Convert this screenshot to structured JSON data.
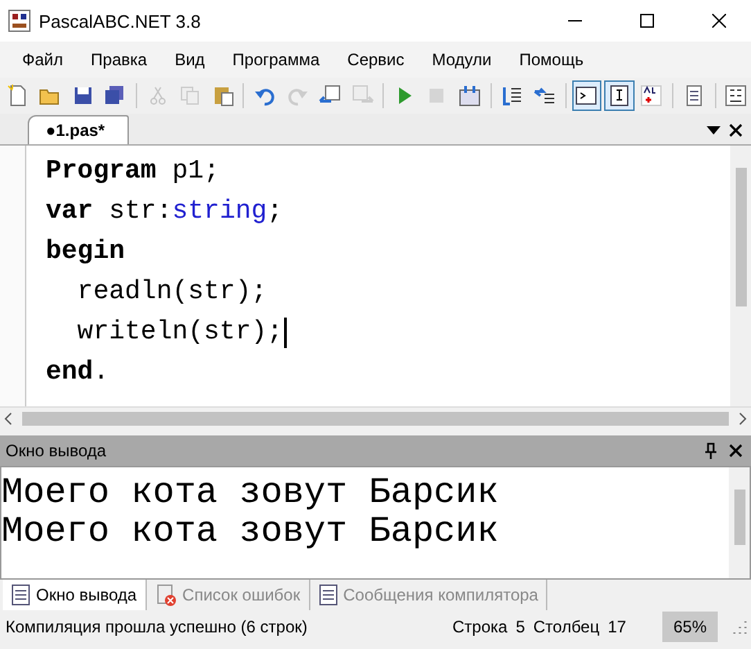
{
  "window": {
    "title": "PascalABC.NET 3.8"
  },
  "menu": [
    "Файл",
    "Правка",
    "Вид",
    "Программа",
    "Сервис",
    "Модули",
    "Помощь"
  ],
  "toolbar": {
    "buttons": [
      {
        "selected": false,
        "disabled": false
      },
      {
        "selected": false,
        "disabled": false
      },
      {
        "selected": false,
        "disabled": false
      },
      {
        "selected": false,
        "disabled": false
      },
      {
        "selected": false,
        "disabled": true
      },
      {
        "selected": false,
        "disabled": true
      },
      {
        "selected": false,
        "disabled": false
      },
      {
        "selected": false,
        "disabled": false
      },
      {
        "selected": false,
        "disabled": true
      },
      {
        "selected": false,
        "disabled": false
      },
      {
        "selected": false,
        "disabled": true
      },
      {
        "selected": false,
        "disabled": false
      },
      {
        "selected": false,
        "disabled": true
      },
      {
        "selected": false,
        "disabled": false
      },
      {
        "selected": false,
        "disabled": false
      },
      {
        "selected": false,
        "disabled": false
      },
      {
        "selected": true,
        "disabled": false
      },
      {
        "selected": true,
        "disabled": false
      },
      {
        "selected": false,
        "disabled": false
      },
      {
        "selected": false,
        "disabled": false
      },
      {
        "selected": false,
        "disabled": false
      }
    ]
  },
  "editor_tabs": [
    {
      "label": "●1.pas*",
      "selected": true
    }
  ],
  "code_lines": [
    {
      "cursor": false,
      "segments": [
        {
          "text": "Program",
          "kind": "keyword"
        },
        {
          "text": " p1;",
          "kind": "plain"
        }
      ]
    },
    {
      "cursor": false,
      "segments": [
        {
          "text": "var",
          "kind": "keyword"
        },
        {
          "text": " str:",
          "kind": "plain"
        },
        {
          "text": "string",
          "kind": "type"
        },
        {
          "text": ";",
          "kind": "plain"
        }
      ]
    },
    {
      "cursor": false,
      "segments": [
        {
          "text": "begin",
          "kind": "keyword"
        }
      ]
    },
    {
      "cursor": false,
      "segments": [
        {
          "text": "  readln(str);",
          "kind": "plain"
        }
      ]
    },
    {
      "cursor": true,
      "segments": [
        {
          "text": "  writeln(str);",
          "kind": "plain"
        }
      ]
    },
    {
      "cursor": false,
      "segments": [
        {
          "text": "end",
          "kind": "keyword"
        },
        {
          "text": ".",
          "kind": "plain"
        }
      ]
    }
  ],
  "output_panel": {
    "title": "Окно вывода",
    "lines": [
      "Моего кота зовут Барсик",
      "Моего кота зовут Барсик"
    ]
  },
  "bottom_tabs": [
    {
      "label": "Окно вывода",
      "selected": true
    },
    {
      "label": "Список ошибок",
      "selected": false
    },
    {
      "label": "Сообщения компилятора",
      "selected": false
    }
  ],
  "status_bar": {
    "message": "Компиляция прошла успешно (6 строк)",
    "line_label": "Строка",
    "line": "5",
    "column_label": "Столбец",
    "column": "17",
    "zoom": "65%"
  }
}
